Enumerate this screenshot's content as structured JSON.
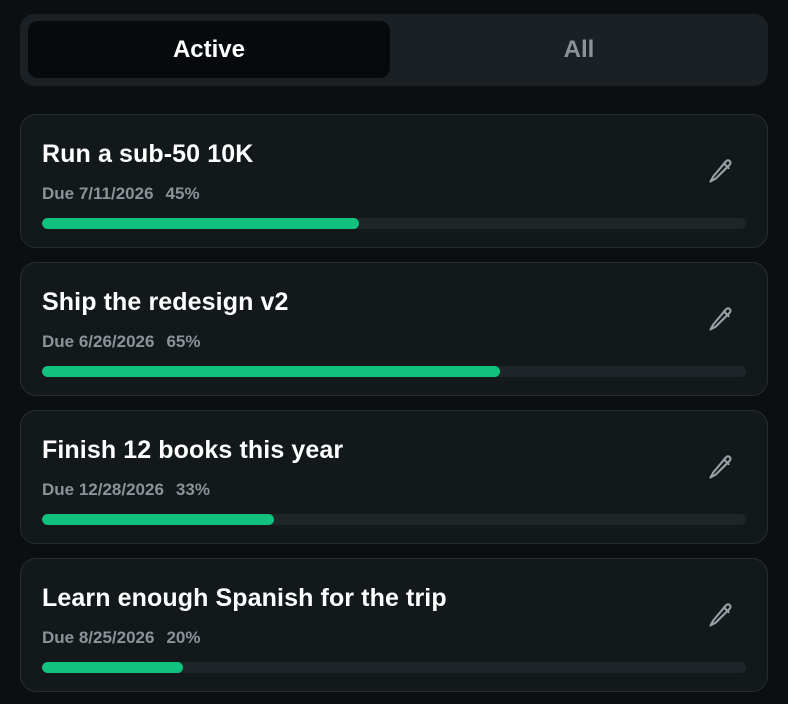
{
  "tabs": {
    "active_label": "Active",
    "all_label": "All",
    "selected": "Active"
  },
  "goals": [
    {
      "title": "Run a sub-50 10K",
      "due": "Due 7/11/2026",
      "percent_label": "45%",
      "progress": 0.45
    },
    {
      "title": "Ship the redesign v2",
      "due": "Due 6/26/2026",
      "percent_label": "65%",
      "progress": 0.65
    },
    {
      "title": "Finish 12 books this year",
      "due": "Due 12/28/2026",
      "percent_label": "33%",
      "progress": 0.33
    },
    {
      "title": "Learn enough Spanish for the trip",
      "due": "Due 8/25/2026",
      "percent_label": "20%",
      "progress": 0.2
    }
  ],
  "icons": {
    "edit": "pencil-icon"
  },
  "colors": {
    "progress_fill": "#12c17e",
    "background": "#0b0f12"
  }
}
